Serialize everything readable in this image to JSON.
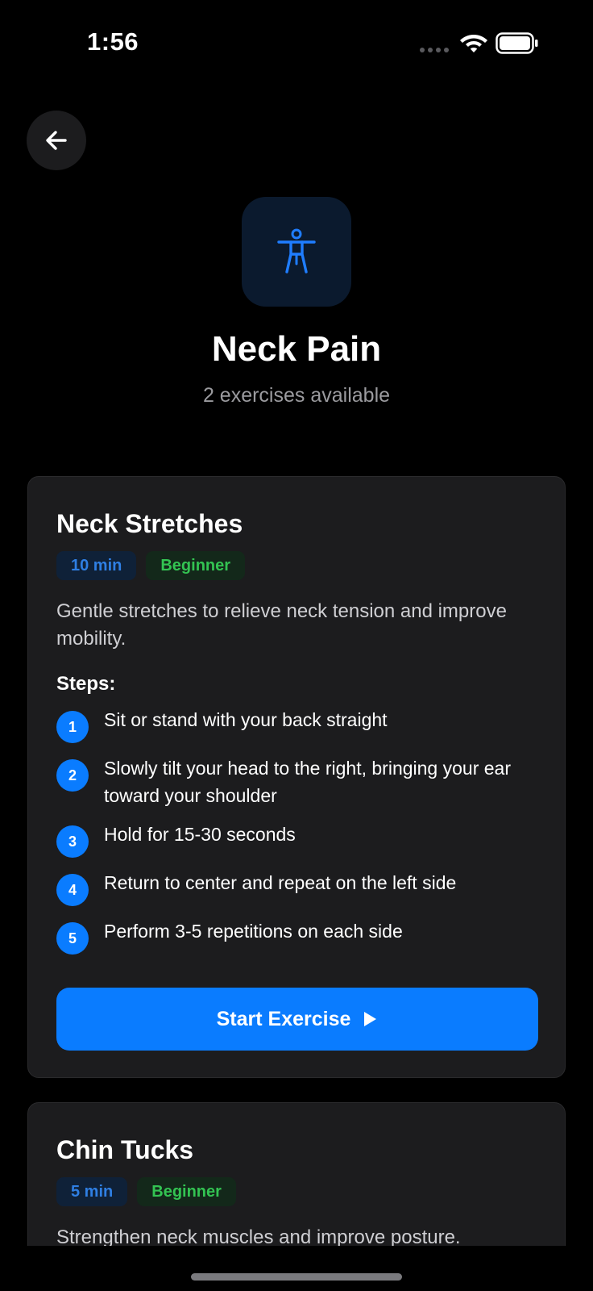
{
  "status_bar": {
    "time": "1:56"
  },
  "header": {
    "title": "Neck Pain",
    "subtitle": "2 exercises available",
    "icon": "person-figure-icon"
  },
  "colors": {
    "accent": "#0a7cff",
    "beginner": "#33c352",
    "card": "#1c1c1e"
  },
  "exercises": [
    {
      "title": "Neck Stretches",
      "duration": "10 min",
      "level": "Beginner",
      "description": "Gentle stretches to relieve neck tension and improve mobility.",
      "steps_label": "Steps:",
      "steps": [
        "Sit or stand with your back straight",
        "Slowly tilt your head to the right, bringing your ear toward your shoulder",
        "Hold for 15-30 seconds",
        "Return to center and repeat on the left side",
        "Perform 3-5 repetitions on each side"
      ],
      "step_numbers": [
        "1",
        "2",
        "3",
        "4",
        "5"
      ],
      "button_label": "Start Exercise"
    },
    {
      "title": "Chin Tucks",
      "duration": "5 min",
      "level": "Beginner",
      "description": "Strengthen neck muscles and improve posture."
    }
  ]
}
